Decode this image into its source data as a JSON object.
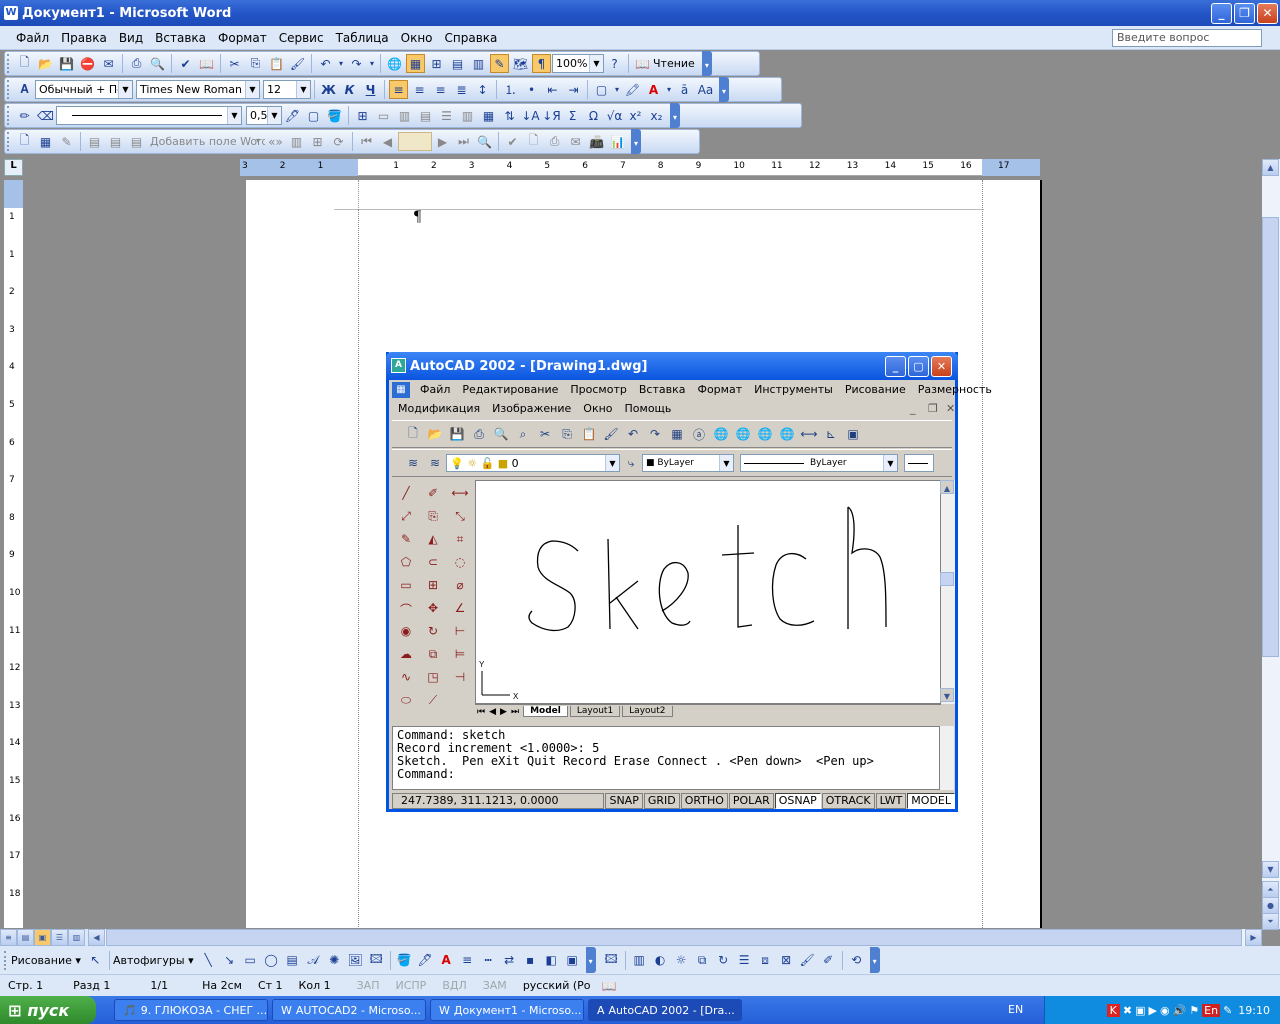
{
  "word": {
    "title": "Документ1 - Microsoft Word",
    "menu": [
      "Файл",
      "Правка",
      "Вид",
      "Вставка",
      "Формат",
      "Сервис",
      "Таблица",
      "Окно",
      "Справка"
    ],
    "help_placeholder": "Введите вопрос",
    "zoom": "100%",
    "reading_label": "Чтение",
    "style": "Обычный + Пер",
    "font": "Times New Roman",
    "font_size": "12",
    "line_weight": "0,5",
    "mailmerge_field": "Добавить поле Word",
    "pilcrow": "¶",
    "draw_label": "Рисование",
    "autoshapes_label": "Автофигуры",
    "status": {
      "page": "Стр. 1",
      "section": "Разд 1",
      "pages": "1/1",
      "at": "На 2см",
      "line": "Ст 1",
      "col": "Кол 1",
      "rec": "ЗАП",
      "trk": "ИСПР",
      "ext": "ВДЛ",
      "ovr": "ЗАМ",
      "lang": "русский (Ро"
    },
    "ruler_h": [
      "3",
      "2",
      "1",
      "1",
      "2",
      "3",
      "4",
      "5",
      "6",
      "7",
      "8",
      "9",
      "10",
      "11",
      "12",
      "13",
      "14",
      "15",
      "16",
      "17"
    ],
    "ruler_v": [
      "1",
      "1",
      "2",
      "3",
      "4",
      "5",
      "6",
      "7",
      "8",
      "9",
      "10",
      "11",
      "12",
      "13",
      "14",
      "15",
      "16",
      "17",
      "18"
    ]
  },
  "acad": {
    "title": "AutoCAD 2002 - [Drawing1.dwg]",
    "menu1": [
      "Файл",
      "Редактирование",
      "Просмотр",
      "Вставка",
      "Формат",
      "Инструменты",
      "Рисование",
      "Размерность"
    ],
    "menu2": [
      "Модификация",
      "Изображение",
      "Окно",
      "Помощь"
    ],
    "layer": "0",
    "color": "ByLayer",
    "linetype": "ByLayer",
    "tabs": [
      "Model",
      "Layout1",
      "Layout2"
    ],
    "command_lines": [
      "Command: sketch",
      "Record increment <1.0000>: 5",
      "Sketch.  Pen eXit Quit Record Erase Connect . <Pen down>  <Pen up>",
      "Command:"
    ],
    "coords": "247.7389, 311.1213, 0.0000",
    "toggles": [
      "SNAP",
      "GRID",
      "ORTHO",
      "POLAR",
      "OSNAP",
      "OTRACK",
      "LWT",
      "MODEL"
    ],
    "ucs_x": "X",
    "ucs_y": "Y"
  },
  "taskbar": {
    "start": "пуск",
    "tasks": [
      "9. ГЛЮКОЗА - СНЕГ ...",
      "AUTOCAD2 - Microso...",
      "Документ1 - Microso...",
      "AutoCAD 2002 - [Dra..."
    ],
    "lang": "EN",
    "time": "19:10"
  }
}
